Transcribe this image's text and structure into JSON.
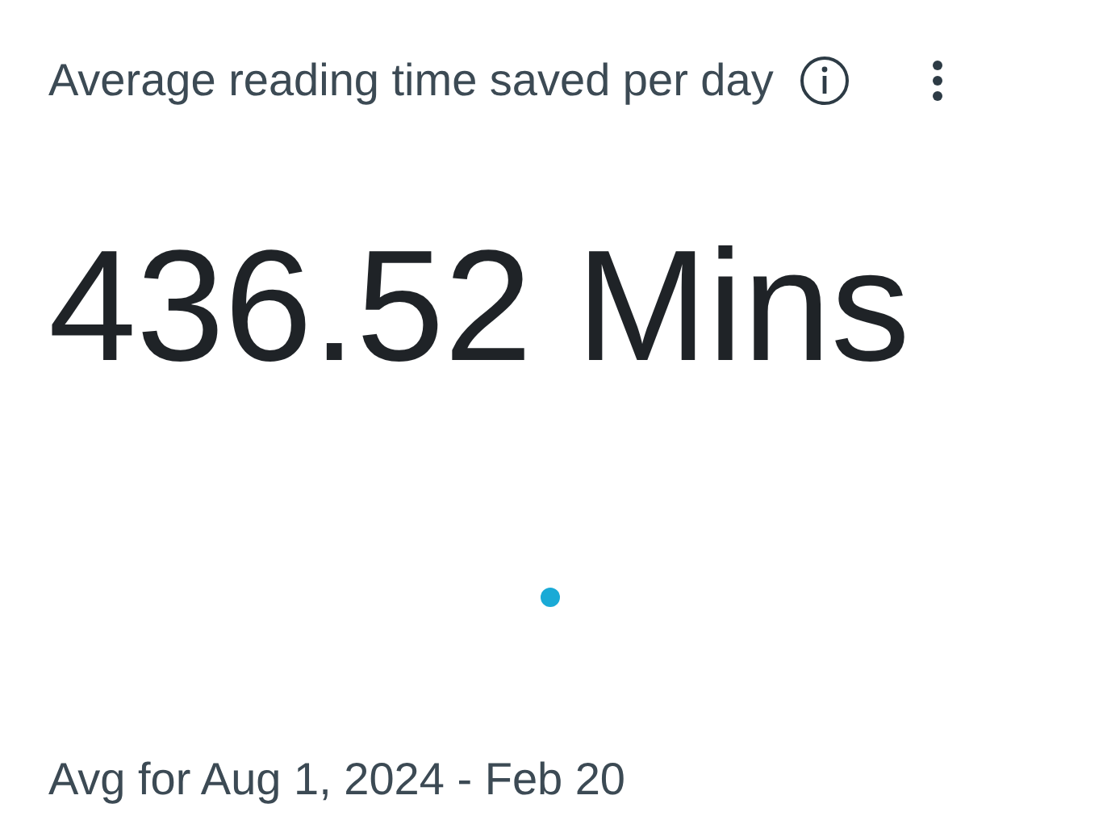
{
  "card": {
    "title": "Average reading time saved per day",
    "value": "436.52 Mins",
    "footer": "Avg for Aug 1, 2024 - Feb 20"
  }
}
